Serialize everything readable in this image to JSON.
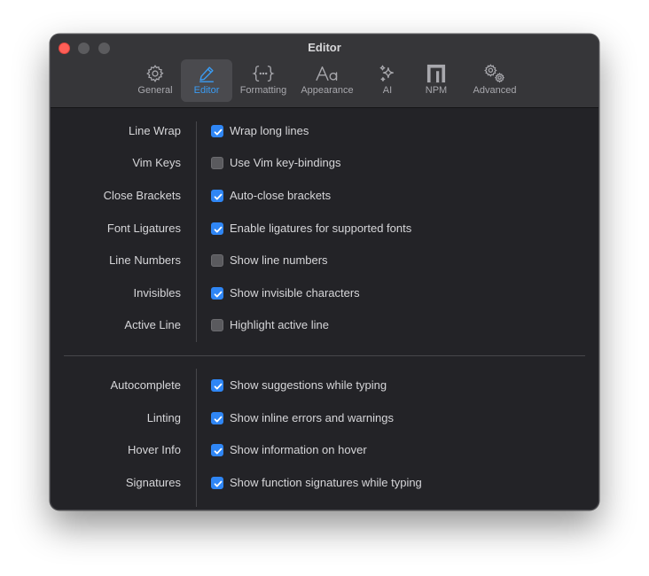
{
  "window": {
    "title": "Editor"
  },
  "colors": {
    "accent": "#2f86f5",
    "active_tab_text": "#3a9cf4",
    "close_button": "#fe5f57",
    "background": "#232327"
  },
  "tabs": [
    {
      "label": "General",
      "icon": "gear-icon",
      "active": false
    },
    {
      "label": "Editor",
      "icon": "pencil-icon",
      "active": true
    },
    {
      "label": "Formatting",
      "icon": "braces-icon",
      "active": false
    },
    {
      "label": "Appearance",
      "icon": "text-size-icon",
      "active": false
    },
    {
      "label": "AI",
      "icon": "sparkles-icon",
      "active": false
    },
    {
      "label": "NPM",
      "icon": "npm-logo-icon",
      "active": false
    },
    {
      "label": "Advanced",
      "icon": "gears-icon",
      "active": false
    }
  ],
  "sections": [
    {
      "rows": [
        {
          "label": "Line Wrap",
          "text": "Wrap long lines",
          "checked": true
        },
        {
          "label": "Vim Keys",
          "text": "Use Vim key-bindings",
          "checked": false
        },
        {
          "label": "Close Brackets",
          "text": "Auto-close brackets",
          "checked": true
        },
        {
          "label": "Font Ligatures",
          "text": "Enable ligatures for supported fonts",
          "checked": true
        },
        {
          "label": "Line Numbers",
          "text": "Show line numbers",
          "checked": false
        },
        {
          "label": "Invisibles",
          "text": "Show invisible characters",
          "checked": true
        },
        {
          "label": "Active Line",
          "text": "Highlight active line",
          "checked": false
        }
      ]
    },
    {
      "rows": [
        {
          "label": "Autocomplete",
          "text": "Show suggestions while typing",
          "checked": true
        },
        {
          "label": "Linting",
          "text": "Show inline errors and warnings",
          "checked": true
        },
        {
          "label": "Hover Info",
          "text": "Show information on hover",
          "checked": true
        },
        {
          "label": "Signatures",
          "text": "Show function signatures while typing",
          "checked": true
        }
      ]
    }
  ]
}
